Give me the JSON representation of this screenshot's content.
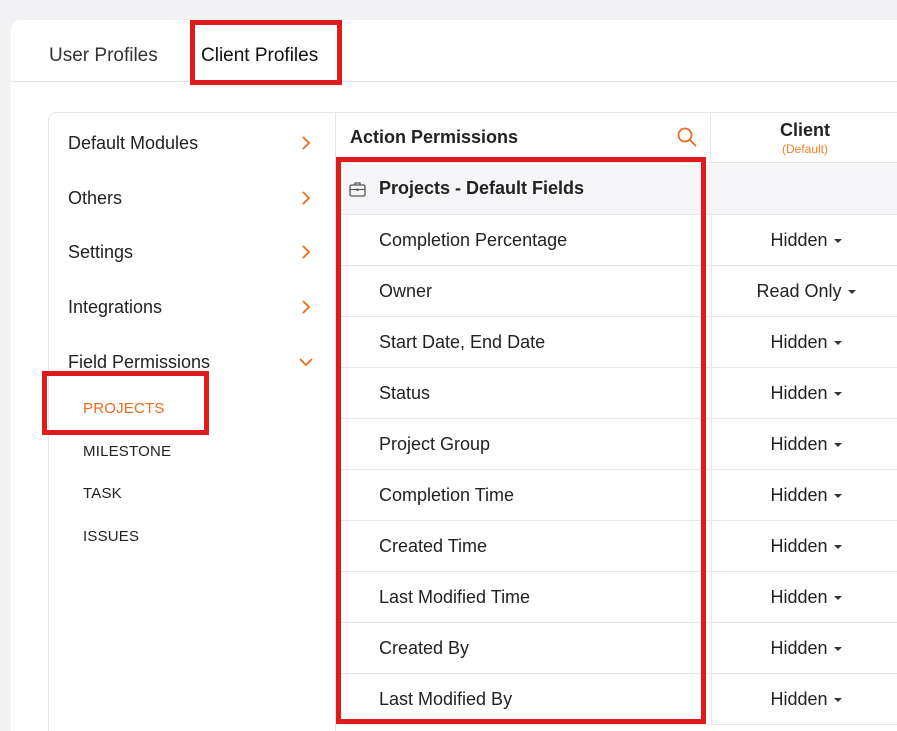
{
  "tabs": {
    "user_profiles": "User Profiles",
    "client_profiles": "Client Profiles"
  },
  "sidebar": {
    "items": [
      {
        "label": "Default Modules"
      },
      {
        "label": "Others"
      },
      {
        "label": "Settings"
      },
      {
        "label": "Integrations"
      },
      {
        "label": "Field Permissions"
      }
    ],
    "sub_items": [
      {
        "label": "PROJECTS",
        "active": true
      },
      {
        "label": "MILESTONE"
      },
      {
        "label": "TASK"
      },
      {
        "label": "ISSUES"
      }
    ]
  },
  "table": {
    "header_title": "Action Permissions",
    "column": {
      "name": "Client",
      "sub": "(Default)"
    },
    "group_title": "Projects - Default Fields",
    "rows": [
      {
        "label": "Completion Percentage",
        "value": "Hidden"
      },
      {
        "label": "Owner",
        "value": "Read Only"
      },
      {
        "label": "Start Date, End Date",
        "value": "Hidden"
      },
      {
        "label": "Status",
        "value": "Hidden"
      },
      {
        "label": "Project Group",
        "value": "Hidden"
      },
      {
        "label": "Completion Time",
        "value": "Hidden"
      },
      {
        "label": "Created Time",
        "value": "Hidden"
      },
      {
        "label": "Last Modified Time",
        "value": "Hidden"
      },
      {
        "label": "Created By",
        "value": "Hidden"
      },
      {
        "label": "Last Modified By",
        "value": "Hidden"
      }
    ]
  },
  "colors": {
    "accent": "#f06a18",
    "highlight": "#e01b1b"
  },
  "icons": {
    "search": "search-icon",
    "chevron_right": "chevron-right-icon",
    "chevron_down": "chevron-down-icon",
    "group": "briefcase-icon",
    "dropdown": "caret-down-icon"
  }
}
